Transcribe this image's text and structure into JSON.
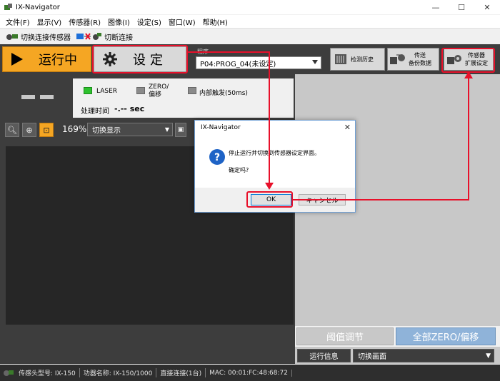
{
  "window": {
    "title": "IX-Navigator",
    "minimize": "—",
    "maximize": "☐",
    "close": "✕"
  },
  "menu": [
    "文件(F)",
    "显示(V)",
    "传感器(R)",
    "图像(I)",
    "设定(S)",
    "窗口(W)",
    "帮助(H)"
  ],
  "toolbar": {
    "switch_sensor": "切换连接传感器",
    "disconnect": "切断连接"
  },
  "command": {
    "run_label": "运行中",
    "setting_label": "设定",
    "program_label": "程序",
    "program_value": "P04:PROG_04(未设定)",
    "history_label": "检测历史",
    "transfer_label_1": "传送",
    "transfer_label_2": "备份数据",
    "sensor_ext_label_1": "传感器",
    "sensor_ext_label_2": "扩展设定"
  },
  "info": {
    "laser": "LASER",
    "zero_1": "ZERO/",
    "zero_2": "偏移",
    "internal_trigger": "内部触发(50ms)",
    "processing_time_label": "处理时间",
    "processing_time_value": "-.-- sec"
  },
  "zoom": {
    "level": "169%",
    "display_mode": "切换显示"
  },
  "bottom": {
    "threshold_label": "阈值调节",
    "zero_all_label": "全部ZERO/偏移",
    "run_info_label": "运行信息",
    "switch_screen_label": "切换画面"
  },
  "status": {
    "sensor_head": "传感头型号: IX-150",
    "amp": "功器名称: IX-150/1000",
    "conn": "直接连接(1台)",
    "mac": "MAC: 00:01:FC:48:68:72"
  },
  "dialog": {
    "title": "IX-Navigator",
    "message": "停止运行并切换到传感器设定界面。",
    "question": "确定吗?",
    "ok": "OK",
    "cancel": "キャンセル"
  },
  "colors": {
    "run_orange": "#f5a623",
    "annotation_red": "#e8102a",
    "zero_blue": "#8fb3d9"
  }
}
